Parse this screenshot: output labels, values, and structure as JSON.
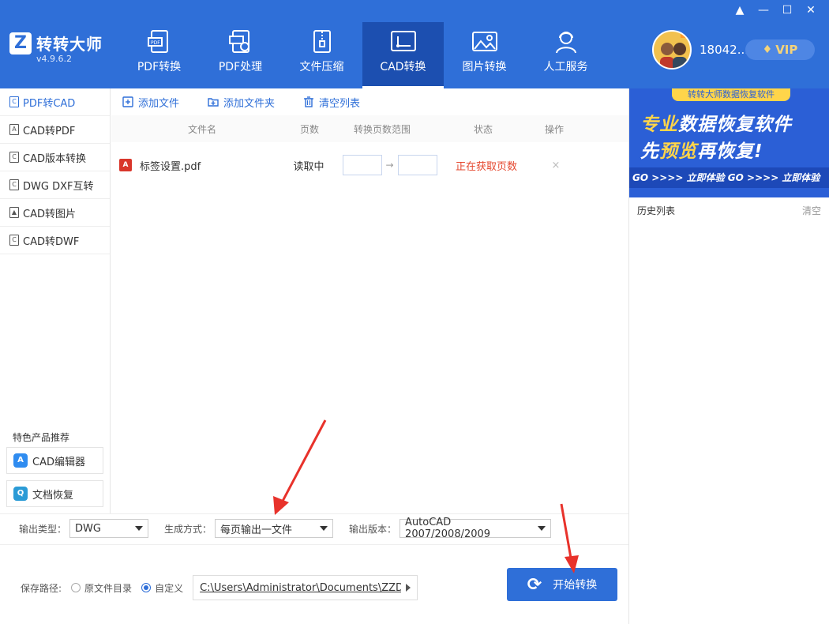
{
  "app": {
    "name": "转转大师",
    "version": "v4.9.6.2",
    "logo_letter": "Z"
  },
  "window_controls": [
    "▲",
    "—",
    "☐",
    "✕"
  ],
  "nav": [
    {
      "label": "PDF转换",
      "icon": "pdf-convert-icon"
    },
    {
      "label": "PDF处理",
      "icon": "pdf-process-icon"
    },
    {
      "label": "文件压缩",
      "icon": "file-compress-icon"
    },
    {
      "label": "CAD转换",
      "icon": "cad-convert-icon",
      "active": true
    },
    {
      "label": "图片转换",
      "icon": "image-convert-icon"
    },
    {
      "label": "人工服务",
      "icon": "support-icon"
    }
  ],
  "user": {
    "id": "18042...",
    "vip_label": "VIP"
  },
  "sidebar": {
    "items": [
      {
        "label": "PDF转CAD",
        "active": true
      },
      {
        "label": "CAD转PDF"
      },
      {
        "label": "CAD版本转换"
      },
      {
        "label": "DWG DXF互转"
      },
      {
        "label": "CAD转图片"
      },
      {
        "label": "CAD转DWF"
      }
    ],
    "feature_title": "特色产品推荐",
    "features": [
      {
        "label": "CAD编辑器",
        "badge": "A",
        "color": "#2f8cf0"
      },
      {
        "label": "文档恢复",
        "badge": "Q",
        "color": "#2b9bd6"
      }
    ]
  },
  "toolbar": {
    "add_file": "添加文件",
    "add_folder": "添加文件夹",
    "clear_list": "清空列表"
  },
  "table": {
    "headers": [
      "文件名",
      "页数",
      "转换页数范围",
      "状态",
      "操作"
    ],
    "rows": [
      {
        "name": "标签设置.pdf",
        "pages": "读取中",
        "range_from": "",
        "range_to": "",
        "status": "正在获取页数",
        "action": "×"
      }
    ]
  },
  "banner": {
    "tag": "转转大师数据恢复软件",
    "line1_a": "专业",
    "line1_b": "数据恢复软件",
    "line2_a": "先",
    "line2_b": "预览",
    "line2_c": "再恢复!",
    "strip": "GO >>>> 立即体验 GO >>>> 立即体验"
  },
  "history": {
    "title": "历史列表",
    "clear": "清空"
  },
  "settings": {
    "output_type_label": "输出类型：",
    "output_type_value": "DWG",
    "gen_mode_label": "生成方式：",
    "gen_mode_value": "每页输出一文件",
    "output_version_label": "输出版本：",
    "output_version_value": "AutoCAD 2007/2008/2009",
    "save_path_label": "保存路径:",
    "radio_original": "原文件目录",
    "radio_custom": "自定义",
    "path_value": "C:\\Users\\Administrator\\Documents\\ZZDS...",
    "start_button": "开始转换"
  },
  "colors": {
    "brand": "#2f6fd8",
    "nav_active": "#1c4fb0",
    "status_red": "#e5472e",
    "annotation_red": "#e8322b"
  }
}
